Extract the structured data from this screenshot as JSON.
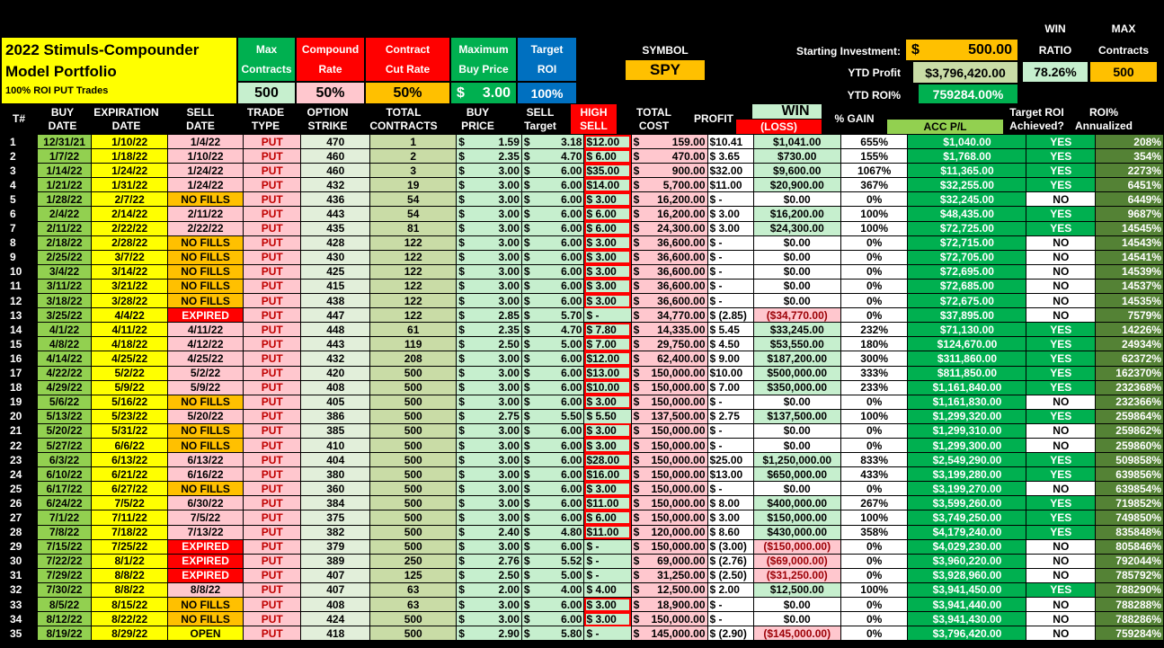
{
  "title": {
    "line1": "2022 Stimuls-Compounder",
    "line2": "Model Portfolio",
    "line3": "100% ROI PUT Trades"
  },
  "params": {
    "max_contracts": {
      "l1": "Max",
      "l2": "Contracts",
      "value": "500"
    },
    "compound_rate": {
      "l1": "Compound",
      "l2": "Rate",
      "value": "50%"
    },
    "contract_cut_rate": {
      "l1": "Contract",
      "l2": "Cut Rate",
      "value": "50%"
    },
    "max_buy_price": {
      "l1": "Maximum",
      "l2": "Buy Price",
      "currency": "$",
      "value": "3.00"
    },
    "target_roi": {
      "l1": "Target",
      "l2": "ROI",
      "value": "100%"
    }
  },
  "symbol": {
    "label": "SYMBOL",
    "value": "SPY"
  },
  "starting_investment": {
    "label": "Starting Investment:",
    "currency": "$",
    "value": "500.00"
  },
  "ytd_profit": {
    "label": "YTD Profit",
    "value": "$3,796,420.00"
  },
  "ytd_roi": {
    "label": "YTD ROI%",
    "value": "759284.00%"
  },
  "win_ratio": {
    "l1": "WIN",
    "l2": "RATIO",
    "value": "78.26%"
  },
  "max_contracts_stat": {
    "l1": "MAX",
    "l2": "Contracts",
    "value": "500"
  },
  "win_header": "WIN",
  "headers": [
    [
      "T#",
      ""
    ],
    [
      "BUY",
      "DATE"
    ],
    [
      "EXPIRATION",
      "DATE"
    ],
    [
      "SELL",
      "DATE"
    ],
    [
      "TRADE",
      "TYPE"
    ],
    [
      "OPTION",
      "STRIKE"
    ],
    [
      "TOTAL",
      "CONTRACTS"
    ],
    [
      "BUY",
      "PRICE"
    ],
    [
      "SELL",
      "Target"
    ],
    [
      "HIGH",
      "SELL"
    ],
    [
      "TOTAL",
      "COST"
    ],
    [
      "",
      "PROFIT"
    ],
    [
      "",
      "(LOSS)"
    ],
    [
      "",
      "% GAIN"
    ],
    [
      "",
      "ACC P/L"
    ],
    [
      "Target ROI",
      "Achieved?"
    ],
    [
      "ROI%",
      "Annualized"
    ]
  ],
  "colors": {
    "green": "#00b050",
    "yellow": "#ffff00",
    "red": "#ff0000",
    "orange": "#ffc000",
    "blue": "#0070c0",
    "light_green": "#c6efce",
    "pink": "#ffc7ce"
  },
  "rows": [
    [
      "1",
      "12/31/21",
      "1/10/22",
      "1/4/22",
      "PUT",
      "470",
      "1",
      "1.59",
      "3.18",
      "$12.00",
      "159.00",
      "$10.41",
      "$1,041.00",
      "655%",
      "$1,040.00",
      "YES",
      "208%"
    ],
    [
      "2",
      "1/7/22",
      "1/18/22",
      "1/10/22",
      "PUT",
      "460",
      "2",
      "2.35",
      "4.70",
      "$ 6.00",
      "470.00",
      "$ 3.65",
      "$730.00",
      "155%",
      "$1,768.00",
      "YES",
      "354%"
    ],
    [
      "3",
      "1/14/22",
      "1/24/22",
      "1/24/22",
      "PUT",
      "460",
      "3",
      "3.00",
      "6.00",
      "$35.00",
      "900.00",
      "$32.00",
      "$9,600.00",
      "1067%",
      "$11,365.00",
      "YES",
      "2273%"
    ],
    [
      "4",
      "1/21/22",
      "1/31/22",
      "1/24/22",
      "PUT",
      "432",
      "19",
      "3.00",
      "6.00",
      "$14.00",
      "5,700.00",
      "$11.00",
      "$20,900.00",
      "367%",
      "$32,255.00",
      "YES",
      "6451%"
    ],
    [
      "5",
      "1/28/22",
      "2/7/22",
      "NO FILLS",
      "PUT",
      "436",
      "54",
      "3.00",
      "6.00",
      "$ 3.00",
      "16,200.00",
      "$ -",
      "$0.00",
      "0%",
      "$32,245.00",
      "NO",
      "6449%"
    ],
    [
      "6",
      "2/4/22",
      "2/14/22",
      "2/11/22",
      "PUT",
      "443",
      "54",
      "3.00",
      "6.00",
      "$ 6.00",
      "16,200.00",
      "$ 3.00",
      "$16,200.00",
      "100%",
      "$48,435.00",
      "YES",
      "9687%"
    ],
    [
      "7",
      "2/11/22",
      "2/22/22",
      "2/22/22",
      "PUT",
      "435",
      "81",
      "3.00",
      "6.00",
      "$ 6.00",
      "24,300.00",
      "$ 3.00",
      "$24,300.00",
      "100%",
      "$72,725.00",
      "YES",
      "14545%"
    ],
    [
      "8",
      "2/18/22",
      "2/28/22",
      "NO FILLS",
      "PUT",
      "428",
      "122",
      "3.00",
      "6.00",
      "$ 3.00",
      "36,600.00",
      "$ -",
      "$0.00",
      "0%",
      "$72,715.00",
      "NO",
      "14543%"
    ],
    [
      "9",
      "2/25/22",
      "3/7/22",
      "NO FILLS",
      "PUT",
      "430",
      "122",
      "3.00",
      "6.00",
      "$ 3.00",
      "36,600.00",
      "$ -",
      "$0.00",
      "0%",
      "$72,705.00",
      "NO",
      "14541%"
    ],
    [
      "10",
      "3/4/22",
      "3/14/22",
      "NO FILLS",
      "PUT",
      "425",
      "122",
      "3.00",
      "6.00",
      "$ 3.00",
      "36,600.00",
      "$ -",
      "$0.00",
      "0%",
      "$72,695.00",
      "NO",
      "14539%"
    ],
    [
      "11",
      "3/11/22",
      "3/21/22",
      "NO FILLS",
      "PUT",
      "415",
      "122",
      "3.00",
      "6.00",
      "$ 3.00",
      "36,600.00",
      "$ -",
      "$0.00",
      "0%",
      "$72,685.00",
      "NO",
      "14537%"
    ],
    [
      "12",
      "3/18/22",
      "3/28/22",
      "NO FILLS",
      "PUT",
      "438",
      "122",
      "3.00",
      "6.00",
      "$ 3.00",
      "36,600.00",
      "$ -",
      "$0.00",
      "0%",
      "$72,675.00",
      "NO",
      "14535%"
    ],
    [
      "13",
      "3/25/22",
      "4/4/22",
      "EXPIRED",
      "PUT",
      "447",
      "122",
      "2.85",
      "5.70",
      "$ -",
      "34,770.00",
      "$ (2.85)",
      "($34,770.00)",
      "0%",
      "$37,895.00",
      "NO",
      "7579%"
    ],
    [
      "14",
      "4/1/22",
      "4/11/22",
      "4/11/22",
      "PUT",
      "448",
      "61",
      "2.35",
      "4.70",
      "$ 7.80",
      "14,335.00",
      "$ 5.45",
      "$33,245.00",
      "232%",
      "$71,130.00",
      "YES",
      "14226%"
    ],
    [
      "15",
      "4/8/22",
      "4/18/22",
      "4/12/22",
      "PUT",
      "443",
      "119",
      "2.50",
      "5.00",
      "$ 7.00",
      "29,750.00",
      "$ 4.50",
      "$53,550.00",
      "180%",
      "$124,670.00",
      "YES",
      "24934%"
    ],
    [
      "16",
      "4/14/22",
      "4/25/22",
      "4/25/22",
      "PUT",
      "432",
      "208",
      "3.00",
      "6.00",
      "$12.00",
      "62,400.00",
      "$ 9.00",
      "$187,200.00",
      "300%",
      "$311,860.00",
      "YES",
      "62372%"
    ],
    [
      "17",
      "4/22/22",
      "5/2/22",
      "5/2/22",
      "PUT",
      "420",
      "500",
      "3.00",
      "6.00",
      "$13.00",
      "150,000.00",
      "$10.00",
      "$500,000.00",
      "333%",
      "$811,850.00",
      "YES",
      "162370%"
    ],
    [
      "18",
      "4/29/22",
      "5/9/22",
      "5/9/22",
      "PUT",
      "408",
      "500",
      "3.00",
      "6.00",
      "$10.00",
      "150,000.00",
      "$ 7.00",
      "$350,000.00",
      "233%",
      "$1,161,840.00",
      "YES",
      "232368%"
    ],
    [
      "19",
      "5/6/22",
      "5/16/22",
      "NO FILLS",
      "PUT",
      "405",
      "500",
      "3.00",
      "6.00",
      "$ 3.00",
      "150,000.00",
      "$ -",
      "$0.00",
      "0%",
      "$1,161,830.00",
      "NO",
      "232366%"
    ],
    [
      "20",
      "5/13/22",
      "5/23/22",
      "5/20/22",
      "PUT",
      "386",
      "500",
      "2.75",
      "5.50",
      "$ 5.50",
      "137,500.00",
      "$ 2.75",
      "$137,500.00",
      "100%",
      "$1,299,320.00",
      "YES",
      "259864%"
    ],
    [
      "21",
      "5/20/22",
      "5/31/22",
      "NO FILLS",
      "PUT",
      "385",
      "500",
      "3.00",
      "6.00",
      "$ 3.00",
      "150,000.00",
      "$ -",
      "$0.00",
      "0%",
      "$1,299,310.00",
      "NO",
      "259862%"
    ],
    [
      "22",
      "5/27/22",
      "6/6/22",
      "NO FILLS",
      "PUT",
      "410",
      "500",
      "3.00",
      "6.00",
      "$ 3.00",
      "150,000.00",
      "$ -",
      "$0.00",
      "0%",
      "$1,299,300.00",
      "NO",
      "259860%"
    ],
    [
      "23",
      "6/3/22",
      "6/13/22",
      "6/13/22",
      "PUT",
      "404",
      "500",
      "3.00",
      "6.00",
      "$28.00",
      "150,000.00",
      "$25.00",
      "$1,250,000.00",
      "833%",
      "$2,549,290.00",
      "YES",
      "509858%"
    ],
    [
      "24",
      "6/10/22",
      "6/21/22",
      "6/16/22",
      "PUT",
      "380",
      "500",
      "3.00",
      "6.00",
      "$16.00",
      "150,000.00",
      "$13.00",
      "$650,000.00",
      "433%",
      "$3,199,280.00",
      "YES",
      "639856%"
    ],
    [
      "25",
      "6/17/22",
      "6/27/22",
      "NO FILLS",
      "PUT",
      "360",
      "500",
      "3.00",
      "6.00",
      "$ 3.00",
      "150,000.00",
      "$ -",
      "$0.00",
      "0%",
      "$3,199,270.00",
      "NO",
      "639854%"
    ],
    [
      "26",
      "6/24/22",
      "7/5/22",
      "6/30/22",
      "PUT",
      "384",
      "500",
      "3.00",
      "6.00",
      "$11.00",
      "150,000.00",
      "$ 8.00",
      "$400,000.00",
      "267%",
      "$3,599,260.00",
      "YES",
      "719852%"
    ],
    [
      "27",
      "7/1/22",
      "7/11/22",
      "7/5/22",
      "PUT",
      "375",
      "500",
      "3.00",
      "6.00",
      "$ 6.00",
      "150,000.00",
      "$ 3.00",
      "$150,000.00",
      "100%",
      "$3,749,250.00",
      "YES",
      "749850%"
    ],
    [
      "28",
      "7/8/22",
      "7/18/22",
      "7/13/22",
      "PUT",
      "382",
      "500",
      "2.40",
      "4.80",
      "$11.00",
      "120,000.00",
      "$ 8.60",
      "$430,000.00",
      "358%",
      "$4,179,240.00",
      "YES",
      "835848%"
    ],
    [
      "29",
      "7/15/22",
      "7/25/22",
      "EXPIRED",
      "PUT",
      "379",
      "500",
      "3.00",
      "6.00",
      "$ -",
      "150,000.00",
      "$ (3.00)",
      "($150,000.00)",
      "0%",
      "$4,029,230.00",
      "NO",
      "805846%"
    ],
    [
      "30",
      "7/22/22",
      "8/1/22",
      "EXPIRED",
      "PUT",
      "389",
      "250",
      "2.76",
      "5.52",
      "$ -",
      "69,000.00",
      "$ (2.76)",
      "($69,000.00)",
      "0%",
      "$3,960,220.00",
      "NO",
      "792044%"
    ],
    [
      "31",
      "7/29/22",
      "8/8/22",
      "EXPIRED",
      "PUT",
      "407",
      "125",
      "2.50",
      "5.00",
      "$ -",
      "31,250.00",
      "$ (2.50)",
      "($31,250.00)",
      "0%",
      "$3,928,960.00",
      "NO",
      "785792%"
    ],
    [
      "32",
      "7/30/22",
      "8/8/22",
      "8/8/22",
      "PUT",
      "407",
      "63",
      "2.00",
      "4.00",
      "$ 4.00",
      "12,500.00",
      "$ 2.00",
      "$12,500.00",
      "100%",
      "$3,941,450.00",
      "YES",
      "788290%"
    ],
    [
      "33",
      "8/5/22",
      "8/15/22",
      "NO FILLS",
      "PUT",
      "408",
      "63",
      "3.00",
      "6.00",
      "$ 3.00",
      "18,900.00",
      "$ -",
      "$0.00",
      "0%",
      "$3,941,440.00",
      "NO",
      "788288%"
    ],
    [
      "34",
      "8/12/22",
      "8/22/22",
      "NO FILLS",
      "PUT",
      "424",
      "500",
      "3.00",
      "6.00",
      "$ 3.00",
      "150,000.00",
      "$ -",
      "$0.00",
      "0%",
      "$3,941,430.00",
      "NO",
      "788286%"
    ],
    [
      "35",
      "8/19/22",
      "8/29/22",
      "OPEN",
      "PUT",
      "418",
      "500",
      "2.90",
      "5.80",
      "$ -",
      "145,000.00",
      "$ (2.90)",
      "($145,000.00)",
      "0%",
      "$3,796,420.00",
      "NO",
      "759284%"
    ]
  ]
}
